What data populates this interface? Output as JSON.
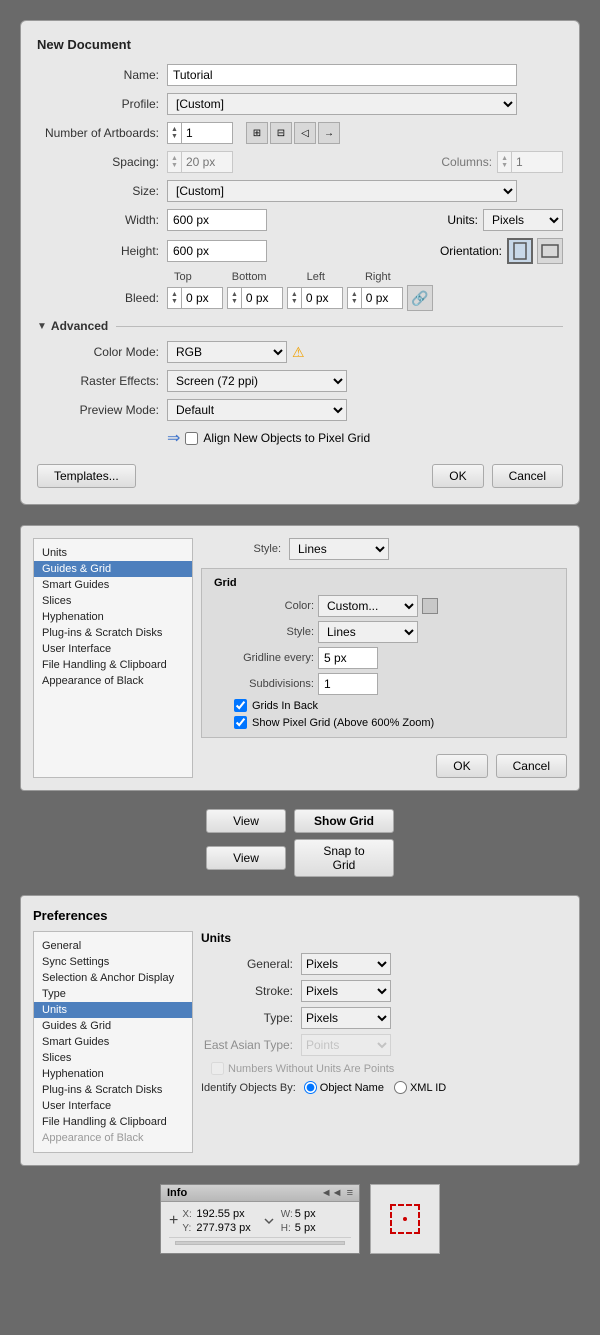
{
  "newDocument": {
    "title": "New Document",
    "name_label": "Name:",
    "name_value": "Tutorial",
    "profile_label": "Profile:",
    "profile_value": "[Custom]",
    "artboards_label": "Number of Artboards:",
    "artboards_value": "1",
    "spacing_label": "Spacing:",
    "spacing_value": "20 px",
    "columns_label": "Columns:",
    "columns_value": "1",
    "size_label": "Size:",
    "size_value": "[Custom]",
    "width_label": "Width:",
    "width_value": "600 px",
    "units_label": "Units:",
    "units_value": "Pixels",
    "height_label": "Height:",
    "height_value": "600 px",
    "orientation_label": "Orientation:",
    "bleed_label": "Bleed:",
    "bleed_top_label": "Top",
    "bleed_bottom_label": "Bottom",
    "bleed_left_label": "Left",
    "bleed_right_label": "Right",
    "bleed_top": "0 px",
    "bleed_bottom": "0 px",
    "bleed_left": "0 px",
    "bleed_right": "0 px",
    "advanced_label": "Advanced",
    "color_mode_label": "Color Mode:",
    "color_mode_value": "RGB",
    "raster_label": "Raster Effects:",
    "raster_value": "Screen (72 ppi)",
    "preview_label": "Preview Mode:",
    "preview_value": "Default",
    "align_label": "Align New Objects to Pixel Grid",
    "templates_btn": "Templates...",
    "ok_btn": "OK",
    "cancel_btn": "Cancel"
  },
  "guidesPrefs": {
    "style_label": "Style:",
    "guide_style_value": "Lines",
    "grid_title": "Grid",
    "color_label": "Color:",
    "color_value": "Custom...",
    "grid_style_label": "Style:",
    "grid_style_value": "Lines",
    "gridline_label": "Gridline every:",
    "gridline_value": "5 px",
    "subdivisions_label": "Subdivisions:",
    "subdivisions_value": "1",
    "grids_back_label": "Grids In Back",
    "show_pixel_label": "Show Pixel Grid (Above 600% Zoom)",
    "ok_btn": "OK",
    "cancel_btn": "Cancel",
    "sidebar_items": [
      "Units",
      "Guides & Grid",
      "Smart Guides",
      "Slices",
      "Hyphenation",
      "Plug-ins & Scratch Disks",
      "User Interface",
      "File Handling & Clipboard",
      "Appearance of Black"
    ],
    "active_item": "Guides & Grid"
  },
  "viewButtons": {
    "view1_label": "View",
    "show_grid_label": "Show Grid",
    "view2_label": "View",
    "snap_grid_label": "Snap to Grid"
  },
  "preferences": {
    "title": "Preferences",
    "sidebar_items": [
      "General",
      "Sync Settings",
      "Selection & Anchor Display",
      "Type",
      "Units",
      "Guides & Grid",
      "Smart Guides",
      "Slices",
      "Hyphenation",
      "Plug-ins & Scratch Disks",
      "User Interface",
      "File Handling & Clipboard",
      "Appearance of Black"
    ],
    "active_item": "Units",
    "content_title": "Units",
    "general_label": "General:",
    "general_value": "Pixels",
    "stroke_label": "Stroke:",
    "stroke_value": "Pixels",
    "type_label": "Type:",
    "type_value": "Pixels",
    "east_asian_label": "East Asian Type:",
    "east_asian_value": "Points",
    "numbers_label": "Numbers Without Units Are Points",
    "identify_label": "Identify Objects By:",
    "object_name_label": "Object Name",
    "xml_id_label": "XML ID"
  },
  "infoPanel": {
    "title": "Info",
    "x_label": "X:",
    "x_value": "192.55 px",
    "y_label": "Y:",
    "y_value": "277.973 px",
    "w_label": "W:",
    "w_value": "5 px",
    "h_label": "H:",
    "h_value": "5 px",
    "expand_icon": "◄◄",
    "menu_icon": "≡"
  }
}
